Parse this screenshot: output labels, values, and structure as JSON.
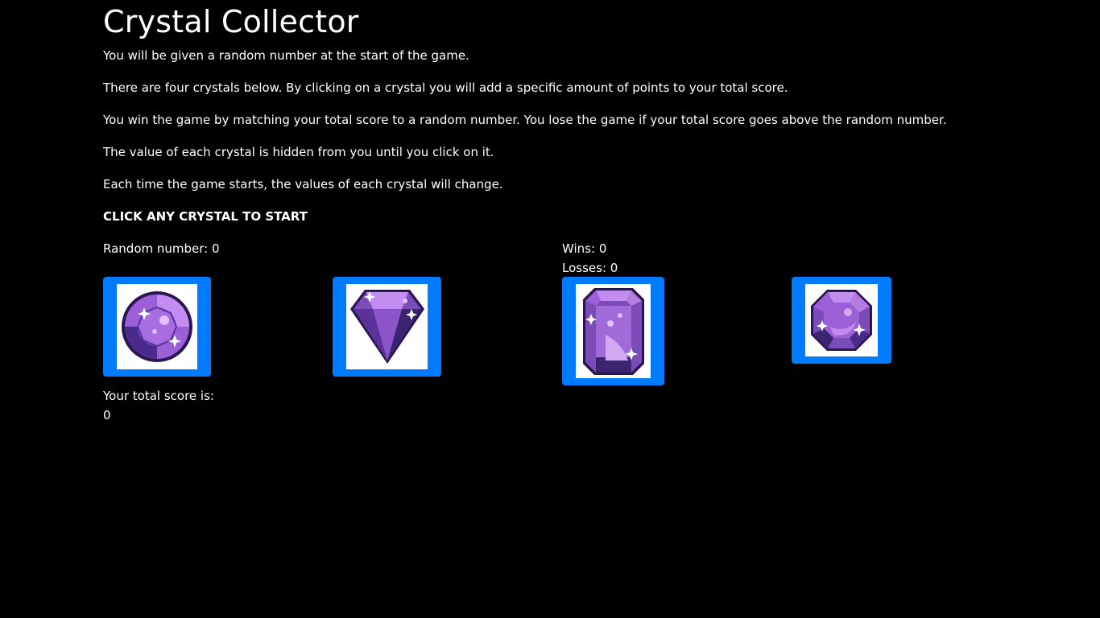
{
  "title": "Crystal Collector",
  "instructions": [
    "You will be given a random number at the start of the game.",
    "There are four crystals below. By clicking on a crystal you will add a specific amount of points to your total score.",
    "You win the game by matching your total score to a random number. You lose the game if your total score goes above the random number.",
    "The value of each crystal is hidden from you until you click on it.",
    "Each time the game starts, the values of each crystal will change."
  ],
  "start_prompt": "CLICK ANY CRYSTAL TO START",
  "random_number": {
    "label": "Random number:",
    "value": "0"
  },
  "stats": {
    "wins_label": "Wins:",
    "wins": "0",
    "losses_label": "Losses:",
    "losses": "0"
  },
  "crystals": [
    {
      "icon": "round-crystal-icon"
    },
    {
      "icon": "diamond-crystal-icon"
    },
    {
      "icon": "emerald-cut-crystal-icon"
    },
    {
      "icon": "octagon-crystal-icon"
    }
  ],
  "score": {
    "label": "Your total score is:",
    "value": "0"
  },
  "colors": {
    "background": "#000000",
    "text": "#ffffff",
    "button": "#007bff",
    "crystal_light": "#b57be0",
    "crystal_mid": "#7b4cb8",
    "crystal_dark": "#3b2470"
  }
}
